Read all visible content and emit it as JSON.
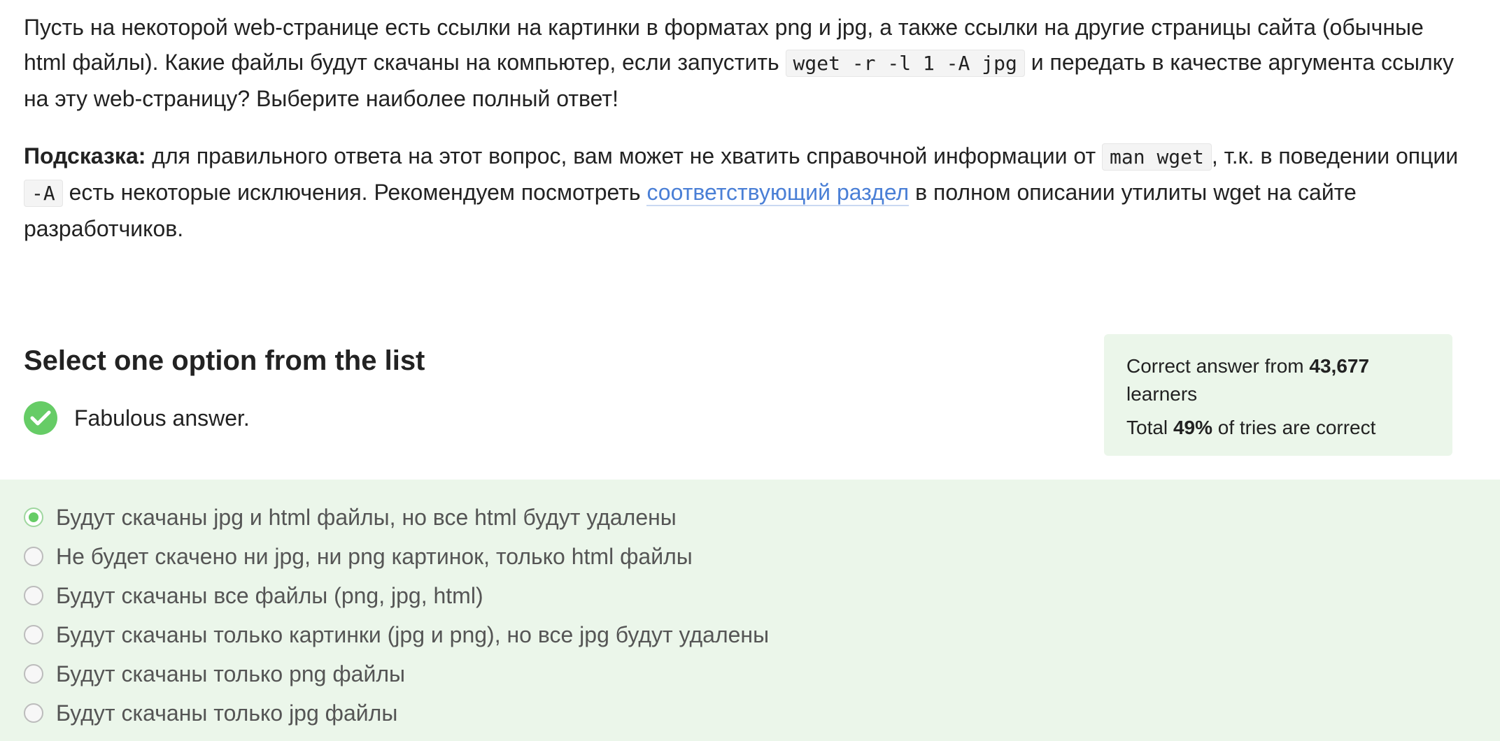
{
  "question": {
    "p1_part1": "Пусть на некоторой web-странице есть ссылки на картинки в форматах png и jpg, а также ссылки на другие страницы сайта (обычные html файлы). Какие файлы будут скачаны на компьютер, если запустить ",
    "p1_code": "wget -r -l 1 -A jpg",
    "p1_part2": " и передать в качестве аргумента ссылку на эту web-страницу? Выберите наиболее полный ответ!",
    "hint_label": "Подсказка:",
    "hint_part1": " для правильного ответа на этот вопрос, вам может не хватить справочной информации от ",
    "hint_code1": "man wget",
    "hint_part2": ", т.к. в поведении опции ",
    "hint_code2": "-A",
    "hint_part3": " есть некоторые исключения. Рекомендуем посмотреть ",
    "hint_link": "соответствующий раздел",
    "hint_part4": " в полном описании утилиты wget на сайте разработчиков."
  },
  "select_heading": "Select one option from the list",
  "feedback": {
    "icon": "checkmark-icon",
    "text": "Fabulous answer."
  },
  "stats": {
    "line1_prefix": "Correct answer from ",
    "learners_count": "43,677",
    "line1_suffix": " learners",
    "line2_prefix": "Total ",
    "percent": "49%",
    "line2_suffix": " of tries are correct"
  },
  "options": [
    {
      "label": "Будут скачаны jpg и html файлы, но все html будут удалены",
      "selected": true
    },
    {
      "label": "Не будет скачено ни jpg, ни png картинок, только html файлы",
      "selected": false
    },
    {
      "label": "Будут скачаны все файлы (png, jpg, html)",
      "selected": false
    },
    {
      "label": "Будут скачаны только картинки (jpg и png), но все jpg будут удалены",
      "selected": false
    },
    {
      "label": "Будут скачаны только png файлы",
      "selected": false
    },
    {
      "label": "Будут скачаны только jpg файлы",
      "selected": false
    }
  ],
  "colors": {
    "accent_green": "#66cc66",
    "panel_bg": "#ebf6ea",
    "link_blue": "#4a7fd6"
  }
}
